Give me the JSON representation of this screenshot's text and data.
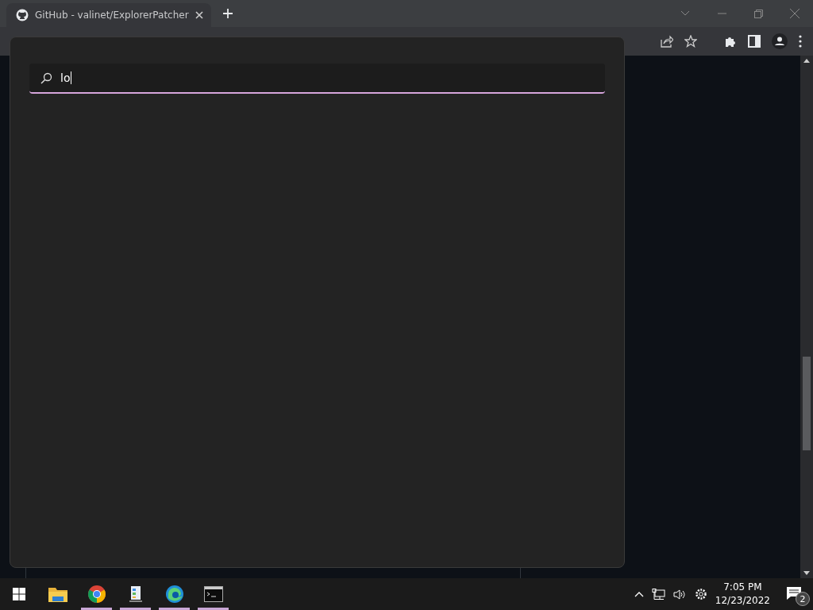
{
  "browser": {
    "tabs": [
      {
        "label": "GitHub - valinet/ExplorerPatcher"
      }
    ]
  },
  "search_panel": {
    "value": "lo"
  },
  "taskbar": {
    "apps": [
      {
        "kind": "folder",
        "running": false
      },
      {
        "kind": "chrome",
        "running": true
      },
      {
        "kind": "notepad",
        "running": true
      },
      {
        "kind": "edge",
        "running": true
      },
      {
        "kind": "terminal",
        "running": true
      }
    ],
    "time": "7:05 PM",
    "date": "12/23/2022",
    "notifications": "2"
  }
}
